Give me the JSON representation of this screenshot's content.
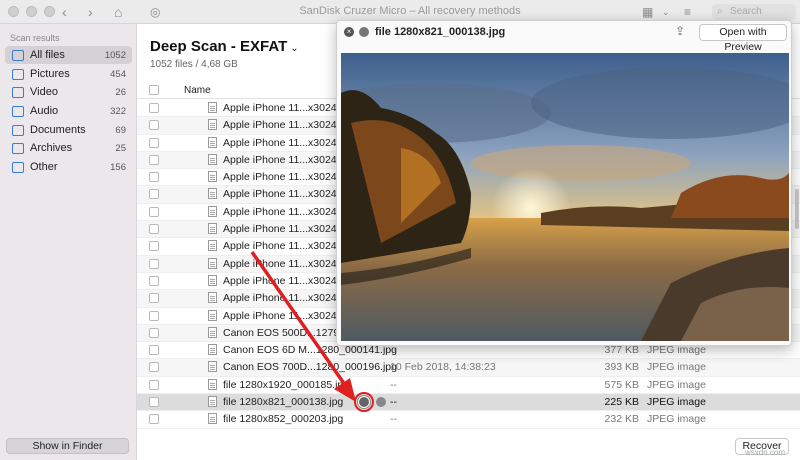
{
  "window": {
    "title": "SanDisk Cruzer Micro – All recovery methods",
    "search_placeholder": "Search"
  },
  "sidebar": {
    "heading": "Scan results",
    "items": [
      {
        "label": "All files",
        "count": "1052"
      },
      {
        "label": "Pictures",
        "count": "454"
      },
      {
        "label": "Video",
        "count": "26"
      },
      {
        "label": "Audio",
        "count": "322"
      },
      {
        "label": "Documents",
        "count": "69"
      },
      {
        "label": "Archives",
        "count": "25"
      },
      {
        "label": "Other",
        "count": "156"
      }
    ],
    "show_in_finder": "Show in Finder"
  },
  "main": {
    "scan_title": "Deep Scan - EXFAT",
    "scan_sub": "1052 files / 4,68 GB",
    "col_name": "Name",
    "rows": [
      {
        "name": "Apple iPhone 11...x3024_0",
        "date": "",
        "size": "",
        "type": ""
      },
      {
        "name": "Apple iPhone 11...x3024_0",
        "date": "",
        "size": "",
        "type": ""
      },
      {
        "name": "Apple iPhone 11...x3024_0",
        "date": "",
        "size": "",
        "type": ""
      },
      {
        "name": "Apple iPhone 11...x3024_0",
        "date": "",
        "size": "",
        "type": ""
      },
      {
        "name": "Apple iPhone 11...x3024_0",
        "date": "",
        "size": "",
        "type": ""
      },
      {
        "name": "Apple iPhone 11...x3024_0",
        "date": "",
        "size": "",
        "type": ""
      },
      {
        "name": "Apple iPhone 11...x3024_0",
        "date": "",
        "size": "",
        "type": ""
      },
      {
        "name": "Apple iPhone 11...x3024_0",
        "date": "",
        "size": "",
        "type": ""
      },
      {
        "name": "Apple iPhone 11...x3024_0",
        "date": "",
        "size": "",
        "type": ""
      },
      {
        "name": "Apple iPhone 11...x3024_0",
        "date": "",
        "size": "",
        "type": ""
      },
      {
        "name": "Apple iPhone 11...x3024_0",
        "date": "",
        "size": "",
        "type": ""
      },
      {
        "name": "Apple iPhone 11...x3024_0",
        "date": "",
        "size": "",
        "type": ""
      },
      {
        "name": "Apple iPhone 11...x3024_0",
        "date": "",
        "size": "",
        "type": ""
      },
      {
        "name": "Canon EOS 500D...1279_0",
        "date": "",
        "size": "",
        "type": ""
      },
      {
        "name": "Canon EOS 6D M...1280_000141.jpg",
        "date": "--",
        "size": "377 KB",
        "type": "JPEG image"
      },
      {
        "name": "Canon EOS 700D...1280_000196.jpg",
        "date": "10 Feb 2018, 14:38:23",
        "size": "393 KB",
        "type": "JPEG image"
      },
      {
        "name": "file 1280x1920_000185.jpg",
        "date": "--",
        "size": "575 KB",
        "type": "JPEG image"
      },
      {
        "name": "file 1280x821_000138.jpg",
        "date": "--",
        "size": "225 KB",
        "type": "JPEG image"
      },
      {
        "name": "file 1280x852_000203.jpg",
        "date": "--",
        "size": "232 KB",
        "type": "JPEG image"
      }
    ],
    "recover_label": "Recover"
  },
  "preview": {
    "title": "file 1280x821_000138.jpg",
    "open_with": "Open with Preview"
  },
  "watermark": "wsxdn.com",
  "colors": {
    "accent": "#3b7bd9",
    "annotation": "#e02020",
    "sidebar_bg": "#ebe7ea"
  }
}
